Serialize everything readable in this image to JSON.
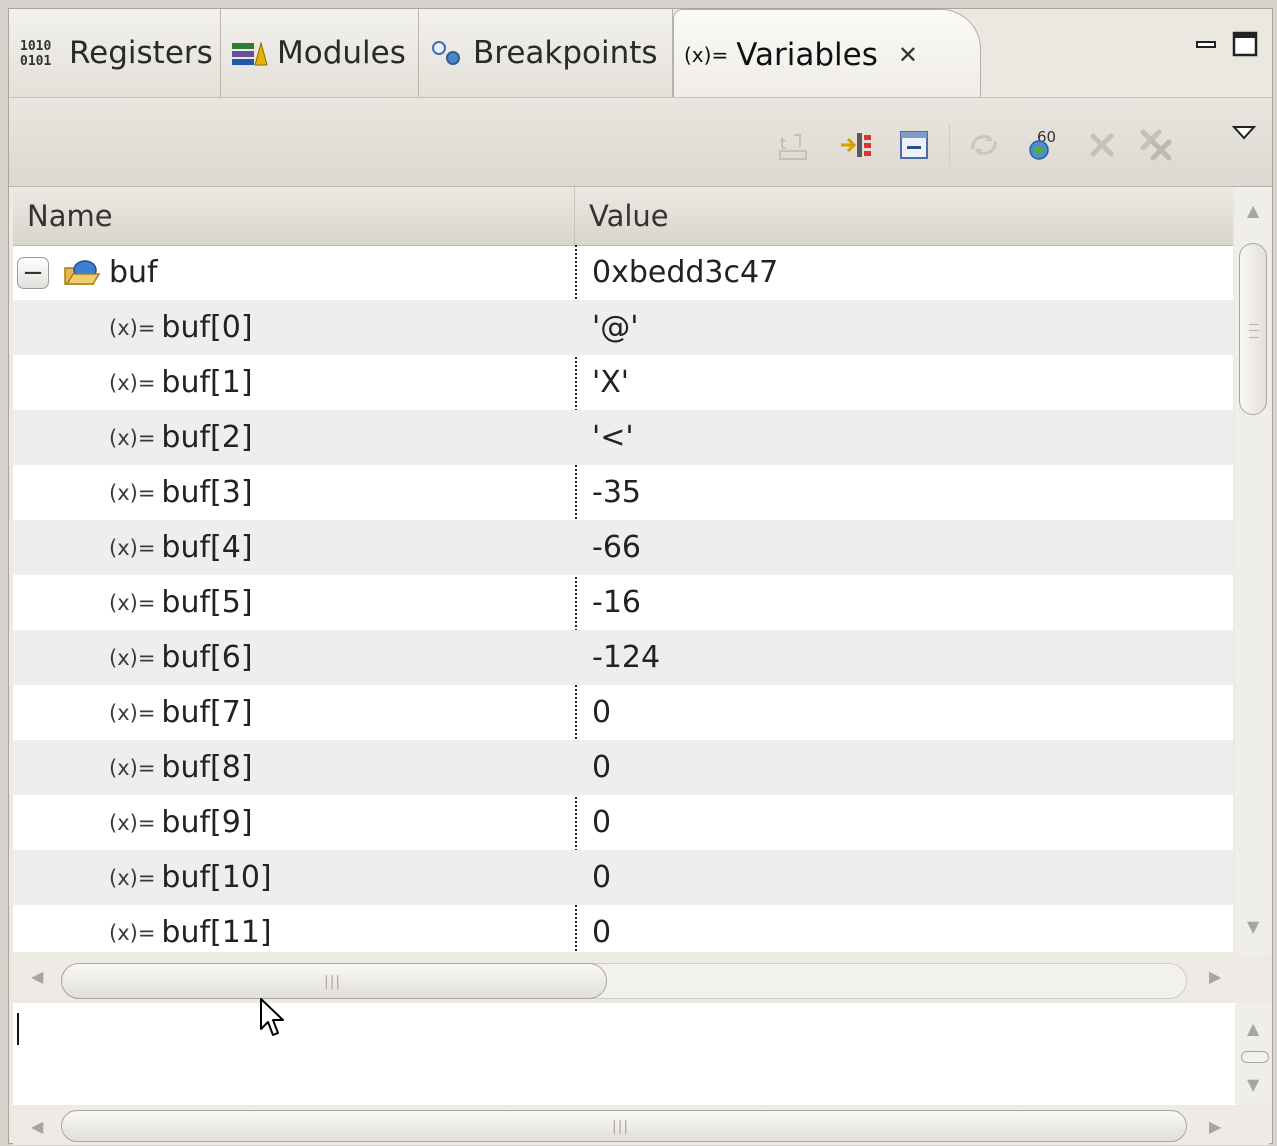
{
  "tabs": [
    {
      "label": "Registers",
      "icon": "registers-icon"
    },
    {
      "label": "Modules",
      "icon": "modules-icon"
    },
    {
      "label": "Breakpoints",
      "icon": "breakpoints-icon"
    },
    {
      "label": "Variables",
      "icon": "variables-icon",
      "active": true
    }
  ],
  "toolbar": {
    "buttons": [
      "show-type-names-icon",
      "show-logical-structure-icon",
      "collapse-all-icon",
      "refresh-icon",
      "add-global-variables-icon",
      "remove-global-variables-icon",
      "remove-all-global-variables-icon"
    ]
  },
  "table": {
    "columns": {
      "name": "Name",
      "value": "Value"
    },
    "rows": [
      {
        "name": "buf",
        "value": "0xbedd3c47",
        "expanded": true
      },
      {
        "name": "buf[0]",
        "value": "'@'"
      },
      {
        "name": "buf[1]",
        "value": "'X'"
      },
      {
        "name": "buf[2]",
        "value": "'<'"
      },
      {
        "name": "buf[3]",
        "value": "-35"
      },
      {
        "name": "buf[4]",
        "value": "-66"
      },
      {
        "name": "buf[5]",
        "value": "-16"
      },
      {
        "name": "buf[6]",
        "value": "-124"
      },
      {
        "name": "buf[7]",
        "value": "0"
      },
      {
        "name": "buf[8]",
        "value": "0"
      },
      {
        "name": "buf[9]",
        "value": "0"
      },
      {
        "name": "buf[10]",
        "value": "0"
      },
      {
        "name": "buf[11]",
        "value": "0"
      }
    ]
  },
  "icons": {
    "variable_glyph": "(x)=",
    "tab_variable_glyph": "(x)=",
    "registers_glyph_line1": "1010",
    "registers_glyph_line2": "0101",
    "expander_glyph": "−",
    "close_glyph": "✕"
  },
  "colors": {
    "row_alt": "#eeeeee",
    "tab_background": "#ebe8e2",
    "struct_icon_blue": "#3b7fd0",
    "folder_yellow": "#e8b84a"
  }
}
